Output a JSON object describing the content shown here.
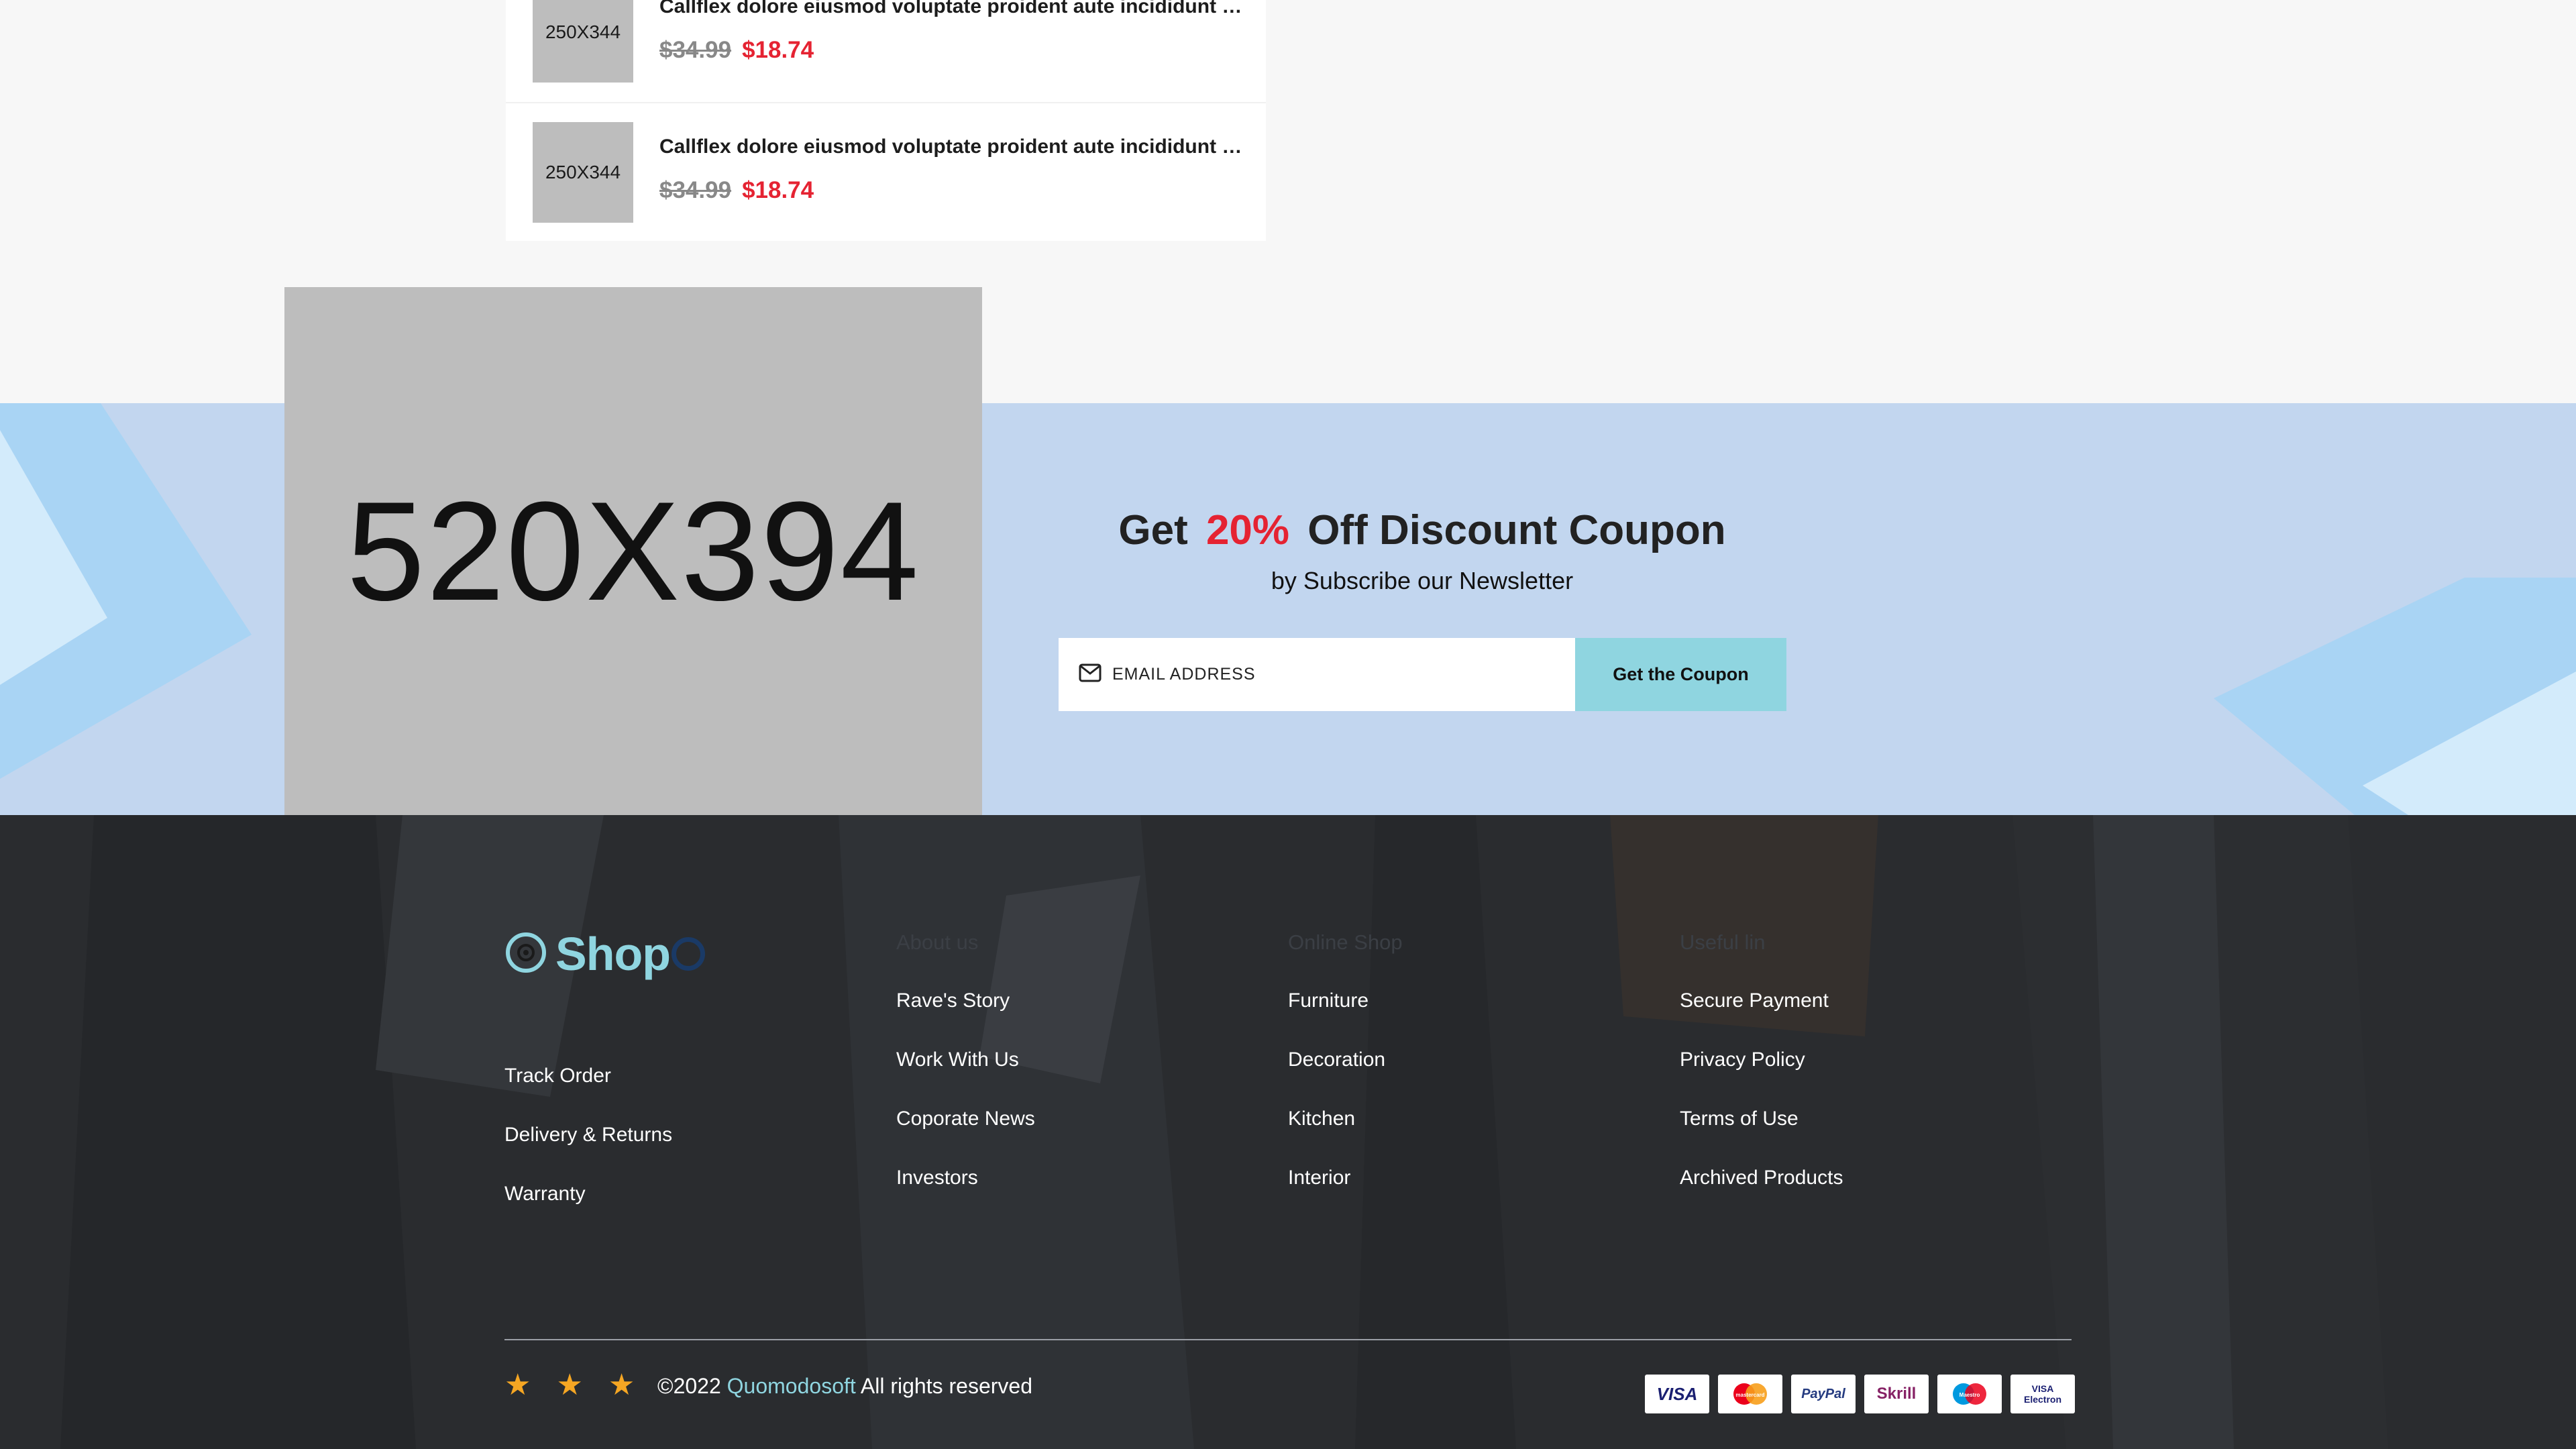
{
  "products": [
    {
      "thumb": "250X344",
      "title": "Callflex dolore eiusmod voluptate proident aute incididunt dolor",
      "old_price": "$34.99",
      "new_price": "$18.74"
    },
    {
      "thumb": "250X344",
      "title": "Callflex dolore eiusmod voluptate proident aute incididunt dolor",
      "old_price": "$34.99",
      "new_price": "$18.74"
    }
  ],
  "newsletter": {
    "image_label": "520X394",
    "heading_pre": "Get",
    "heading_pct": "20%",
    "heading_post": "Off Discount Coupon",
    "subheading": "by Subscribe our Newsletter",
    "email_placeholder": "EMAIL ADDRESS",
    "button_label": "Get the Coupon"
  },
  "footer": {
    "logo_text": "Shop",
    "columns": [
      {
        "heading": "",
        "links": [
          "Track Order",
          "Delivery & Returns",
          "Warranty"
        ]
      },
      {
        "heading": "About us",
        "links": [
          "Rave's Story",
          "Work With Us",
          "Coporate News",
          "Investors"
        ]
      },
      {
        "heading": "Online Shop",
        "links": [
          "Furniture",
          "Decoration",
          "Kitchen",
          "Interior"
        ]
      },
      {
        "heading": "Useful lin",
        "links": [
          "Secure Payment",
          "Privacy Policy",
          "Terms of Use",
          "Archived Products"
        ]
      }
    ],
    "copyright_pre": "©2022",
    "copyright_brand": "Quomodosoft",
    "copyright_post": "All rights reserved",
    "payment_methods": [
      "VISA",
      "mastercard",
      "PayPal",
      "Skrill",
      "Maestro",
      "VISA Electron"
    ]
  },
  "colors": {
    "accent_cyan": "#8fd5e0",
    "price_red": "#e52332",
    "newsletter_bg": "#c2d6ef",
    "footer_bg": "#2a2c2f",
    "star": "#f5a623"
  }
}
